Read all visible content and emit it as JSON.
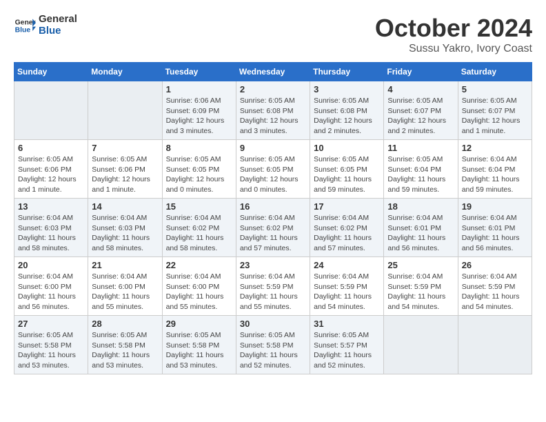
{
  "header": {
    "logo_line1": "General",
    "logo_line2": "Blue",
    "month": "October 2024",
    "location": "Sussu Yakro, Ivory Coast"
  },
  "weekdays": [
    "Sunday",
    "Monday",
    "Tuesday",
    "Wednesday",
    "Thursday",
    "Friday",
    "Saturday"
  ],
  "rows": [
    [
      {
        "day": "",
        "info": ""
      },
      {
        "day": "",
        "info": ""
      },
      {
        "day": "1",
        "info": "Sunrise: 6:06 AM\nSunset: 6:09 PM\nDaylight: 12 hours and 3 minutes."
      },
      {
        "day": "2",
        "info": "Sunrise: 6:05 AM\nSunset: 6:08 PM\nDaylight: 12 hours and 3 minutes."
      },
      {
        "day": "3",
        "info": "Sunrise: 6:05 AM\nSunset: 6:08 PM\nDaylight: 12 hours and 2 minutes."
      },
      {
        "day": "4",
        "info": "Sunrise: 6:05 AM\nSunset: 6:07 PM\nDaylight: 12 hours and 2 minutes."
      },
      {
        "day": "5",
        "info": "Sunrise: 6:05 AM\nSunset: 6:07 PM\nDaylight: 12 hours and 1 minute."
      }
    ],
    [
      {
        "day": "6",
        "info": "Sunrise: 6:05 AM\nSunset: 6:06 PM\nDaylight: 12 hours and 1 minute."
      },
      {
        "day": "7",
        "info": "Sunrise: 6:05 AM\nSunset: 6:06 PM\nDaylight: 12 hours and 1 minute."
      },
      {
        "day": "8",
        "info": "Sunrise: 6:05 AM\nSunset: 6:05 PM\nDaylight: 12 hours and 0 minutes."
      },
      {
        "day": "9",
        "info": "Sunrise: 6:05 AM\nSunset: 6:05 PM\nDaylight: 12 hours and 0 minutes."
      },
      {
        "day": "10",
        "info": "Sunrise: 6:05 AM\nSunset: 6:05 PM\nDaylight: 11 hours and 59 minutes."
      },
      {
        "day": "11",
        "info": "Sunrise: 6:05 AM\nSunset: 6:04 PM\nDaylight: 11 hours and 59 minutes."
      },
      {
        "day": "12",
        "info": "Sunrise: 6:04 AM\nSunset: 6:04 PM\nDaylight: 11 hours and 59 minutes."
      }
    ],
    [
      {
        "day": "13",
        "info": "Sunrise: 6:04 AM\nSunset: 6:03 PM\nDaylight: 11 hours and 58 minutes."
      },
      {
        "day": "14",
        "info": "Sunrise: 6:04 AM\nSunset: 6:03 PM\nDaylight: 11 hours and 58 minutes."
      },
      {
        "day": "15",
        "info": "Sunrise: 6:04 AM\nSunset: 6:02 PM\nDaylight: 11 hours and 58 minutes."
      },
      {
        "day": "16",
        "info": "Sunrise: 6:04 AM\nSunset: 6:02 PM\nDaylight: 11 hours and 57 minutes."
      },
      {
        "day": "17",
        "info": "Sunrise: 6:04 AM\nSunset: 6:02 PM\nDaylight: 11 hours and 57 minutes."
      },
      {
        "day": "18",
        "info": "Sunrise: 6:04 AM\nSunset: 6:01 PM\nDaylight: 11 hours and 56 minutes."
      },
      {
        "day": "19",
        "info": "Sunrise: 6:04 AM\nSunset: 6:01 PM\nDaylight: 11 hours and 56 minutes."
      }
    ],
    [
      {
        "day": "20",
        "info": "Sunrise: 6:04 AM\nSunset: 6:00 PM\nDaylight: 11 hours and 56 minutes."
      },
      {
        "day": "21",
        "info": "Sunrise: 6:04 AM\nSunset: 6:00 PM\nDaylight: 11 hours and 55 minutes."
      },
      {
        "day": "22",
        "info": "Sunrise: 6:04 AM\nSunset: 6:00 PM\nDaylight: 11 hours and 55 minutes."
      },
      {
        "day": "23",
        "info": "Sunrise: 6:04 AM\nSunset: 5:59 PM\nDaylight: 11 hours and 55 minutes."
      },
      {
        "day": "24",
        "info": "Sunrise: 6:04 AM\nSunset: 5:59 PM\nDaylight: 11 hours and 54 minutes."
      },
      {
        "day": "25",
        "info": "Sunrise: 6:04 AM\nSunset: 5:59 PM\nDaylight: 11 hours and 54 minutes."
      },
      {
        "day": "26",
        "info": "Sunrise: 6:04 AM\nSunset: 5:59 PM\nDaylight: 11 hours and 54 minutes."
      }
    ],
    [
      {
        "day": "27",
        "info": "Sunrise: 6:05 AM\nSunset: 5:58 PM\nDaylight: 11 hours and 53 minutes."
      },
      {
        "day": "28",
        "info": "Sunrise: 6:05 AM\nSunset: 5:58 PM\nDaylight: 11 hours and 53 minutes."
      },
      {
        "day": "29",
        "info": "Sunrise: 6:05 AM\nSunset: 5:58 PM\nDaylight: 11 hours and 53 minutes."
      },
      {
        "day": "30",
        "info": "Sunrise: 6:05 AM\nSunset: 5:58 PM\nDaylight: 11 hours and 52 minutes."
      },
      {
        "day": "31",
        "info": "Sunrise: 6:05 AM\nSunset: 5:57 PM\nDaylight: 11 hours and 52 minutes."
      },
      {
        "day": "",
        "info": ""
      },
      {
        "day": "",
        "info": ""
      }
    ]
  ]
}
